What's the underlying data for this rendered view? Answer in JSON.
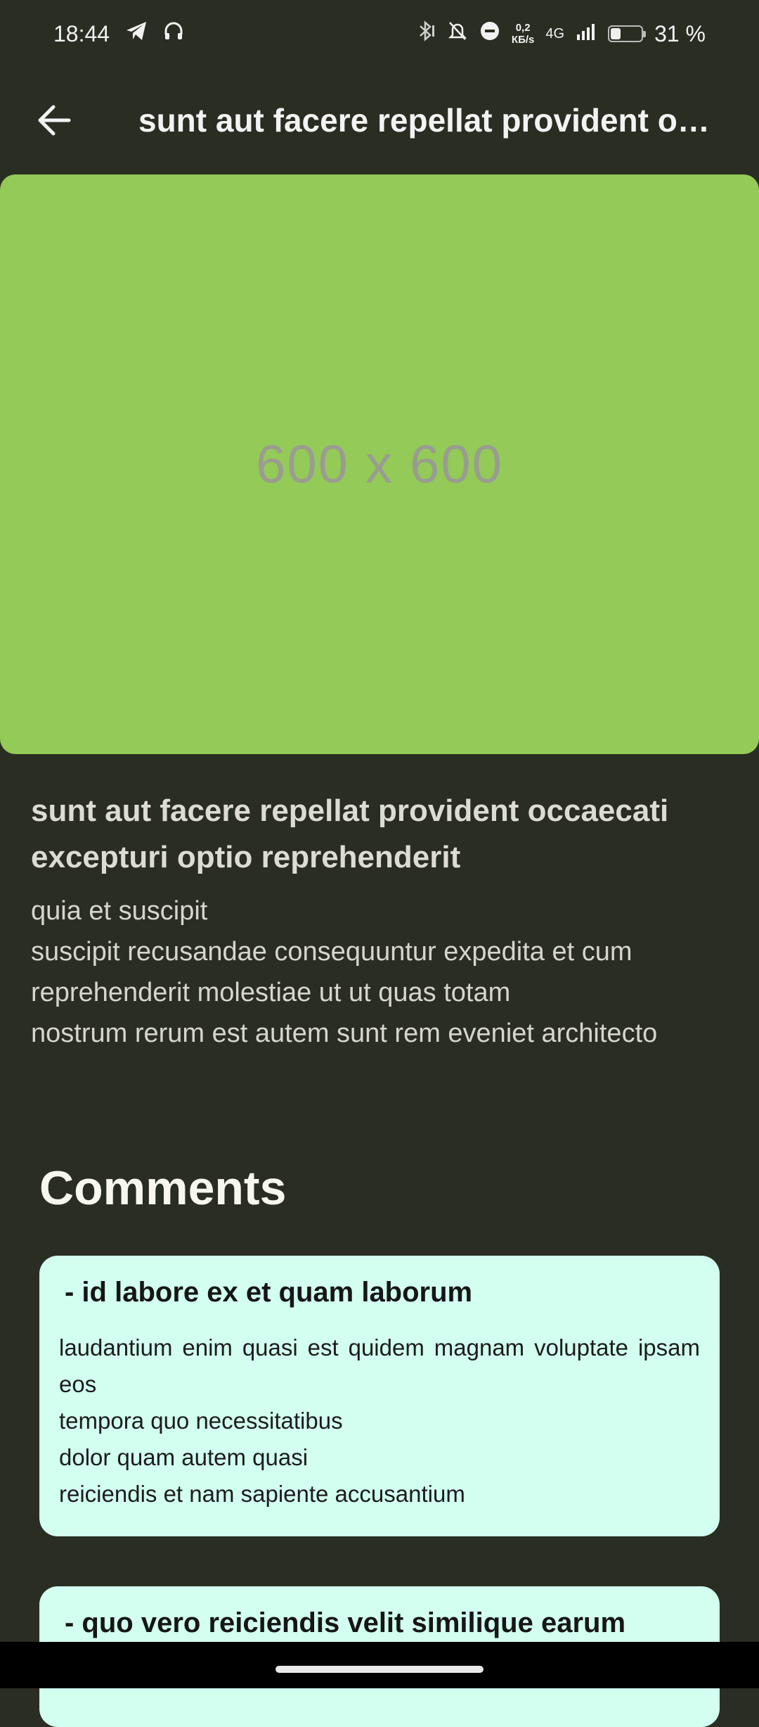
{
  "status_bar": {
    "time": "18:44",
    "net_speed_value": "0,2",
    "net_speed_unit": "КБ/s",
    "network": "4G",
    "battery": "31 %",
    "battery_level": 0.31
  },
  "app_bar": {
    "title": "sunt aut facere repellat provident occaecati excepturi optio reprehenderit"
  },
  "hero": {
    "placeholder_text": "600 x 600",
    "color": "#94ca57"
  },
  "post": {
    "title": "sunt aut facere repellat provident occaecati excepturi optio reprehenderit",
    "body": "quia et suscipit\nsuscipit recusandae consequuntur expedita et cum reprehenderit molestiae ut ut quas totam\nnostrum rerum est autem sunt rem eveniet architecto"
  },
  "comments": {
    "heading": "Comments",
    "items": [
      {
        "name": " - id labore ex et quam laborum",
        "body": "laudantium enim quasi est quidem magnam voluptate ipsam eos\ntempora quo necessitatibus\ndolor quam autem quasi\nreiciendis et nam sapiente accusantium"
      },
      {
        "name": " - quo vero reiciendis velit similique earum",
        "body": ""
      }
    ]
  },
  "colors": {
    "background": "#2a2d22",
    "card": "#d2fff0"
  }
}
